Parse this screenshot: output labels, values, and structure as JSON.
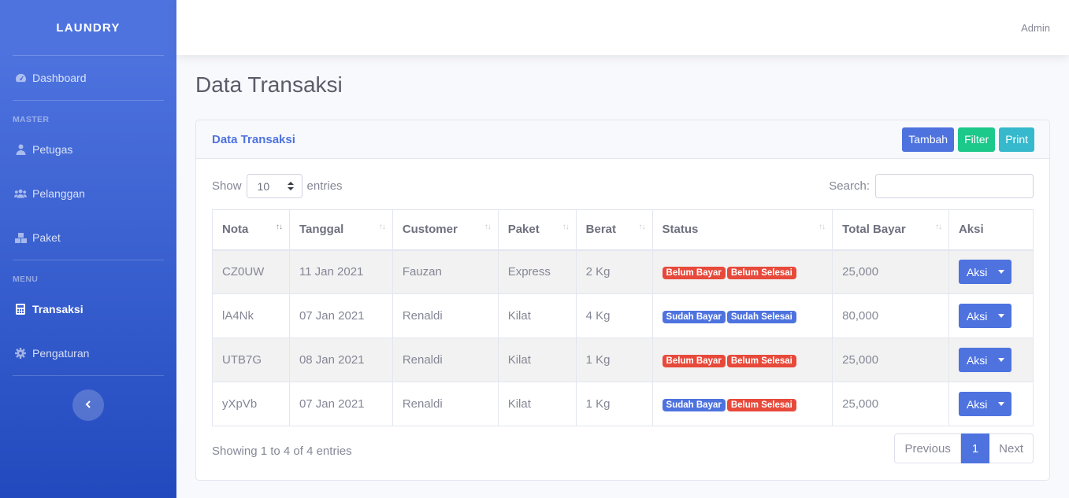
{
  "sidebar": {
    "brand": "LAUNDRY",
    "dashboard": "Dashboard",
    "heading_master": "MASTER",
    "petugas": "Petugas",
    "pelanggan": "Pelanggan",
    "paket": "Paket",
    "heading_menu": "MENU",
    "transaksi": "Transaksi",
    "pengaturan": "Pengaturan",
    "toggle_icon": "chevron-left-icon"
  },
  "topbar": {
    "user": "Admin"
  },
  "page": {
    "title": "Data Transaksi"
  },
  "card": {
    "title": "Data Transaksi",
    "buttons": {
      "tambah": "Tambah",
      "filter": "Filter",
      "print": "Print"
    }
  },
  "controls": {
    "show_label": "Show",
    "entries_value": "10",
    "entries_label": "entries",
    "search_label": "Search:",
    "search_value": ""
  },
  "table": {
    "headers": [
      "Nota",
      "Tanggal",
      "Customer",
      "Paket",
      "Berat",
      "Status",
      "Total Bayar",
      "Aksi"
    ],
    "rows": [
      {
        "nota": "CZ0UW",
        "tanggal": "11 Jan 2021",
        "customer": "Fauzan",
        "paket": "Express",
        "berat": "2 Kg",
        "bayar": "Belum Bayar",
        "selesai": "Belum Selesai",
        "total": "25,000",
        "aksi": "Aksi"
      },
      {
        "nota": "lA4Nk",
        "tanggal": "07 Jan 2021",
        "customer": "Renaldi",
        "paket": "Kilat",
        "berat": "4 Kg",
        "bayar": "Sudah Bayar",
        "selesai": "Sudah Selesai",
        "total": "80,000",
        "aksi": "Aksi"
      },
      {
        "nota": "UTB7G",
        "tanggal": "08 Jan 2021",
        "customer": "Renaldi",
        "paket": "Kilat",
        "berat": "1 Kg",
        "bayar": "Belum Bayar",
        "selesai": "Belum Selesai",
        "total": "25,000",
        "aksi": "Aksi"
      },
      {
        "nota": "yXpVb",
        "tanggal": "07 Jan 2021",
        "customer": "Renaldi",
        "paket": "Kilat",
        "berat": "1 Kg",
        "bayar": "Sudah Bayar",
        "selesai": "Belum Selesai",
        "total": "25,000",
        "aksi": "Aksi"
      }
    ]
  },
  "footer": {
    "info": "Showing 1 to 4 of 4 entries",
    "previous": "Previous",
    "current_page": "1",
    "next": "Next"
  },
  "colors": {
    "primary": "#4e73df",
    "success": "#1cc88a",
    "info": "#36b9cc",
    "danger": "#e74a3b"
  }
}
